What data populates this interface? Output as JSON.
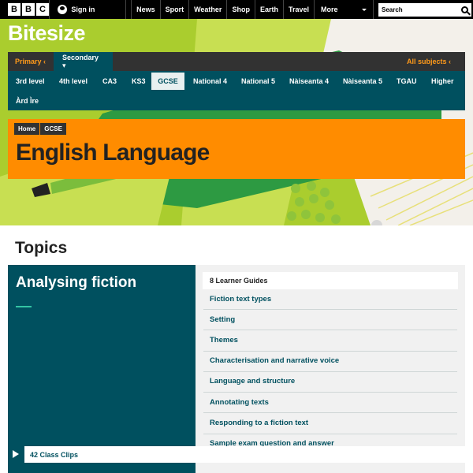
{
  "bbc": {
    "logo_letters": [
      "B",
      "B",
      "C"
    ],
    "sign_in": "Sign in",
    "nav": [
      "News",
      "Sport",
      "Weather",
      "Shop",
      "Earth",
      "Travel"
    ],
    "more": "More",
    "search_placeholder": "Search"
  },
  "brand": {
    "name": "Bitesize"
  },
  "levels": {
    "primary": "Primary ‹",
    "secondary": "Secondary ▾",
    "all_subjects": "All subjects ‹"
  },
  "qualifications": [
    {
      "label": "3rd level",
      "active": false
    },
    {
      "label": "4th level",
      "active": false
    },
    {
      "label": "CA3",
      "active": false
    },
    {
      "label": "KS3",
      "active": false
    },
    {
      "label": "GCSE",
      "active": true
    },
    {
      "label": "National 4",
      "active": false
    },
    {
      "label": "National 5",
      "active": false
    },
    {
      "label": "Nàiseanta 4",
      "active": false
    },
    {
      "label": "Nàiseanta 5",
      "active": false
    },
    {
      "label": "TGAU",
      "active": false
    },
    {
      "label": "Higher",
      "active": false
    },
    {
      "label": "Àrd Ìre",
      "active": false
    }
  ],
  "breadcrumb": [
    "Home",
    "GCSE"
  ],
  "page_title": "English Language",
  "topics": {
    "heading": "Topics",
    "card_title": "Analysing fiction",
    "guides_header": "8 Learner Guides",
    "guides": [
      "Fiction text types",
      "Setting",
      "Themes",
      "Characterisation and narrative voice",
      "Language and structure",
      "Annotating texts",
      "Responding to a fiction text",
      "Sample exam question and answer"
    ],
    "clips": "42 Class Clips"
  },
  "colors": {
    "teal": "#00505f",
    "orange": "#ff8c00",
    "green": "#aacd2e",
    "dark": "#323232"
  }
}
